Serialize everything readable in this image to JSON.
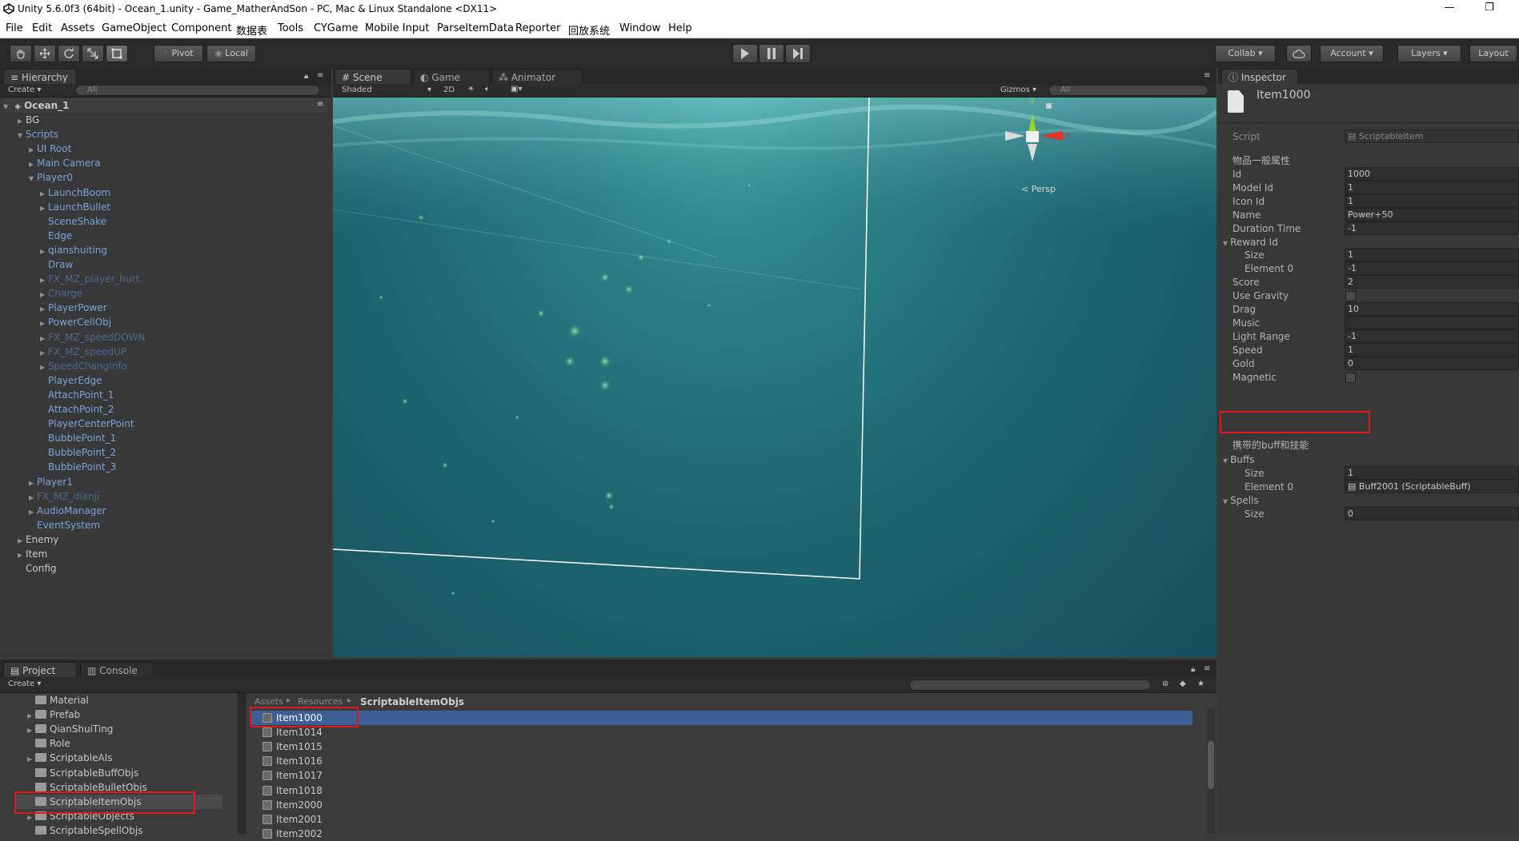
{
  "window": {
    "title": "Unity 5.6.0f3 (64bit) - Ocean_1.unity - Game_MatherAndSon - PC, Mac & Linux Standalone <DX11>",
    "minimize_glyph": "—",
    "restore_glyph": "❐"
  },
  "menu": [
    "File",
    "Edit",
    "Assets",
    "GameObject",
    "Component",
    "数据表",
    "Tools",
    "CYGame",
    "Mobile Input",
    "ParseItemData",
    "Reporter",
    "回放系统",
    "Window",
    "Help"
  ],
  "toolbar": {
    "pivot_label": "Pivot",
    "local_label": "Local",
    "collab_label": "Collab ▾",
    "account_label": "Account ▾",
    "layers_label": "Layers ▾",
    "layout_label": "Layout"
  },
  "hierarchy": {
    "tab_label": "Hierarchy",
    "create_label": "Create ▾",
    "search_placeholder": "All",
    "scene_name": "Ocean_1",
    "rows": [
      {
        "label": "BG",
        "indent": 1,
        "arrow": "right",
        "color": "white"
      },
      {
        "label": "Scripts",
        "indent": 1,
        "arrow": "down",
        "color": "blue"
      },
      {
        "label": "UI Root",
        "indent": 2,
        "arrow": "right",
        "color": "blue"
      },
      {
        "label": "Main Camera",
        "indent": 2,
        "arrow": "right",
        "color": "blue"
      },
      {
        "label": "Player0",
        "indent": 2,
        "arrow": "down",
        "color": "blue"
      },
      {
        "label": "LaunchBoom",
        "indent": 3,
        "arrow": "right",
        "color": "blue"
      },
      {
        "label": "LaunchBullet",
        "indent": 3,
        "arrow": "right",
        "color": "blue"
      },
      {
        "label": "SceneShake",
        "indent": 3,
        "arrow": "",
        "color": "blue"
      },
      {
        "label": "Edge",
        "indent": 3,
        "arrow": "",
        "color": "blue"
      },
      {
        "label": "qianshuiting",
        "indent": 3,
        "arrow": "right",
        "color": "blue"
      },
      {
        "label": "Draw",
        "indent": 3,
        "arrow": "",
        "color": "blue"
      },
      {
        "label": "FX_MZ_player_hurt",
        "indent": 3,
        "arrow": "right",
        "color": "dim"
      },
      {
        "label": "Charge",
        "indent": 3,
        "arrow": "right",
        "color": "dim"
      },
      {
        "label": "PlayerPower",
        "indent": 3,
        "arrow": "right",
        "color": "blue"
      },
      {
        "label": "PowerCellObj",
        "indent": 3,
        "arrow": "right",
        "color": "blue"
      },
      {
        "label": "FX_MZ_speedDOWN",
        "indent": 3,
        "arrow": "right",
        "color": "dim"
      },
      {
        "label": "FX_MZ_speedUP",
        "indent": 3,
        "arrow": "right",
        "color": "dim"
      },
      {
        "label": "SpeedChangInfo",
        "indent": 3,
        "arrow": "right",
        "color": "dim"
      },
      {
        "label": "PlayerEdge",
        "indent": 3,
        "arrow": "",
        "color": "blue"
      },
      {
        "label": "AttachPoint_1",
        "indent": 3,
        "arrow": "",
        "color": "blue"
      },
      {
        "label": "AttachPoint_2",
        "indent": 3,
        "arrow": "",
        "color": "blue"
      },
      {
        "label": "PlayerCenterPoint",
        "indent": 3,
        "arrow": "",
        "color": "blue"
      },
      {
        "label": "BubblePoint_1",
        "indent": 3,
        "arrow": "",
        "color": "blue"
      },
      {
        "label": "BubblePoint_2",
        "indent": 3,
        "arrow": "",
        "color": "blue"
      },
      {
        "label": "BubblePoint_3",
        "indent": 3,
        "arrow": "",
        "color": "blue"
      },
      {
        "label": "Player1",
        "indent": 2,
        "arrow": "right",
        "color": "blue"
      },
      {
        "label": "FX_MZ_dianji",
        "indent": 2,
        "arrow": "right",
        "color": "dim"
      },
      {
        "label": "AudioManager",
        "indent": 2,
        "arrow": "right",
        "color": "blue"
      },
      {
        "label": "EventSystem",
        "indent": 2,
        "arrow": "",
        "color": "blue"
      },
      {
        "label": "Enemy",
        "indent": 1,
        "arrow": "right",
        "color": "white"
      },
      {
        "label": "Item",
        "indent": 1,
        "arrow": "right",
        "color": "white"
      },
      {
        "label": "Config",
        "indent": 1,
        "arrow": "",
        "color": "white"
      }
    ]
  },
  "scene": {
    "tabs": [
      "Scene",
      "Game",
      "Animator"
    ],
    "shading_mode": "Shaded",
    "mode_2d": "2D",
    "gizmos_label": "Gizmos ▾",
    "search_placeholder": "All",
    "persp_label": "Persp",
    "gizmo_axes": {
      "y": "y",
      "x": "x"
    }
  },
  "inspector": {
    "tab_label": "Inspector",
    "object_name": "Item1000",
    "script_label": "Script",
    "script_value": "ScriptableItem",
    "section_general": "物品一般属性",
    "fields": [
      {
        "label": "Id",
        "value": "1000",
        "type": "text",
        "indent": 0
      },
      {
        "label": "Model Id",
        "value": "1",
        "type": "text",
        "indent": 0
      },
      {
        "label": "Icon Id",
        "value": "1",
        "type": "text",
        "indent": 0
      },
      {
        "label": "Name",
        "value": "Power+50",
        "type": "text",
        "indent": 0
      },
      {
        "label": "Duration Time",
        "value": "-1",
        "type": "text",
        "indent": 0
      },
      {
        "label": "Reward Id",
        "value": "",
        "type": "foldout",
        "indent": 0
      },
      {
        "label": "Size",
        "value": "1",
        "type": "text",
        "indent": 1
      },
      {
        "label": "Element 0",
        "value": "-1",
        "type": "text",
        "indent": 1
      },
      {
        "label": "Score",
        "value": "2",
        "type": "text",
        "indent": 0
      },
      {
        "label": "Use Gravity",
        "value": "",
        "type": "check",
        "indent": 0
      },
      {
        "label": "Drag",
        "value": "10",
        "type": "text",
        "indent": 0
      },
      {
        "label": "Music",
        "value": "",
        "type": "text",
        "indent": 0
      },
      {
        "label": "Light Range",
        "value": "-1",
        "type": "text",
        "indent": 0
      },
      {
        "label": "Speed",
        "value": "1",
        "type": "text",
        "indent": 0
      },
      {
        "label": "Gold",
        "value": "0",
        "type": "text",
        "indent": 0
      },
      {
        "label": "Magnetic",
        "value": "",
        "type": "check",
        "indent": 0
      }
    ],
    "section_buff": "携带的buff和技能",
    "buff_fields": [
      {
        "label": "Buffs",
        "value": "",
        "type": "foldout",
        "indent": 0
      },
      {
        "label": "Size",
        "value": "1",
        "type": "text",
        "indent": 1
      },
      {
        "label": "Element 0",
        "value": "Buff2001 (ScriptableBuff)",
        "type": "object",
        "indent": 1
      },
      {
        "label": "Spells",
        "value": "",
        "type": "foldout",
        "indent": 0
      },
      {
        "label": "Size",
        "value": "0",
        "type": "text",
        "indent": 1
      }
    ]
  },
  "project": {
    "tabs": [
      "Project",
      "Console"
    ],
    "create_label": "Create ▾",
    "breadcrumb": [
      "Assets",
      "Resources",
      "ScriptableItemObjs"
    ],
    "folders": [
      {
        "label": "Material",
        "arrow": ""
      },
      {
        "label": "Prefab",
        "arrow": "right"
      },
      {
        "label": "QianShuiTing",
        "arrow": "right"
      },
      {
        "label": "Role",
        "arrow": ""
      },
      {
        "label": "ScriptableAIs",
        "arrow": "right"
      },
      {
        "label": "ScriptableBuffObjs",
        "arrow": ""
      },
      {
        "label": "ScriptableBulletObjs",
        "arrow": ""
      },
      {
        "label": "ScriptableItemObjs",
        "arrow": ""
      },
      {
        "label": "ScriptableObjects",
        "arrow": "right"
      },
      {
        "label": "ScriptableSpellObjs",
        "arrow": ""
      }
    ],
    "assets": [
      "Item1000",
      "Item1014",
      "Item1015",
      "Item1016",
      "Item1017",
      "Item1018",
      "Item2000",
      "Item2001",
      "Item2002"
    ]
  },
  "colors": {
    "highlight_red": "#e0191f",
    "selection_blue": "#3e5f96",
    "hierarchy_blue": "#7aa4dc"
  }
}
